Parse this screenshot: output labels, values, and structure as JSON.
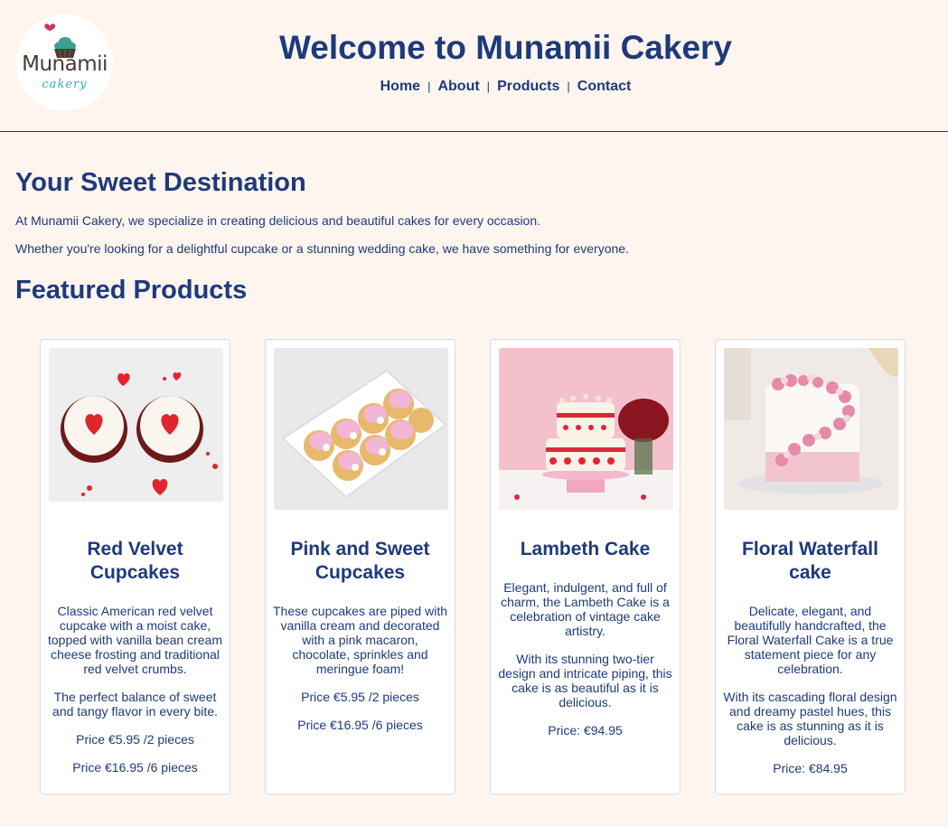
{
  "brand": {
    "logo_word": "Munamii",
    "logo_sub": "cakery"
  },
  "header": {
    "title": "Welcome to Munamii Cakery"
  },
  "nav": {
    "items": [
      {
        "label": "Home"
      },
      {
        "label": "About"
      },
      {
        "label": "Products"
      },
      {
        "label": "Contact"
      }
    ],
    "separator": "|"
  },
  "intro": {
    "heading": "Your Sweet Destination",
    "p1": "At Munamii Cakery, we specialize in creating delicious and beautiful cakes for every occasion.",
    "p2": "Whether you're looking for a delightful cupcake or a stunning wedding cake, we have something for everyone."
  },
  "featured": {
    "heading": "Featured Products",
    "products": [
      {
        "title": "Red Velvet Cupcakes",
        "image_alt": "red velvet cupcakes with heart toppers",
        "desc1": "Classic American red velvet cupcake with a moist cake, topped with vanilla bean cream cheese frosting and traditional red velvet crumbs.",
        "desc2": "The perfect balance of sweet and tangy flavor in every bite.",
        "price1": "Price €5.95 /2 pieces",
        "price2": "Price €16.95 /6 pieces"
      },
      {
        "title": "Pink and Sweet Cupcakes",
        "image_alt": "box of pink macaron cupcakes",
        "desc1": "These cupcakes are piped with vanilla cream and decorated with a pink macaron, chocolate, sprinkles and meringue foam!",
        "desc2": "",
        "price1": "Price €5.95 /2 pieces",
        "price2": "Price €16.95 /6 pieces"
      },
      {
        "title": "Lambeth Cake",
        "image_alt": "two-tier vintage piped cake",
        "desc1": "Elegant, indulgent, and full of charm, the Lambeth Cake is a celebration of vintage cake artistry.",
        "desc2": "With its stunning two-tier design and intricate piping, this cake is as beautiful as it is delicious.",
        "price1": "Price: €94.95",
        "price2": ""
      },
      {
        "title": "Floral Waterfall cake",
        "image_alt": "white cake with cascading pink flowers",
        "desc1": "Delicate, elegant, and beautifully handcrafted, the Floral Waterfall Cake is a true statement piece for any celebration.",
        "desc2": "With its cascading floral design and dreamy pastel hues, this cake is as stunning as it is delicious.",
        "price1": "Price: €84.95",
        "price2": ""
      }
    ]
  },
  "colors": {
    "background": "#fdf5ee",
    "text": "#1e3a7b",
    "card": "#ffffff"
  }
}
